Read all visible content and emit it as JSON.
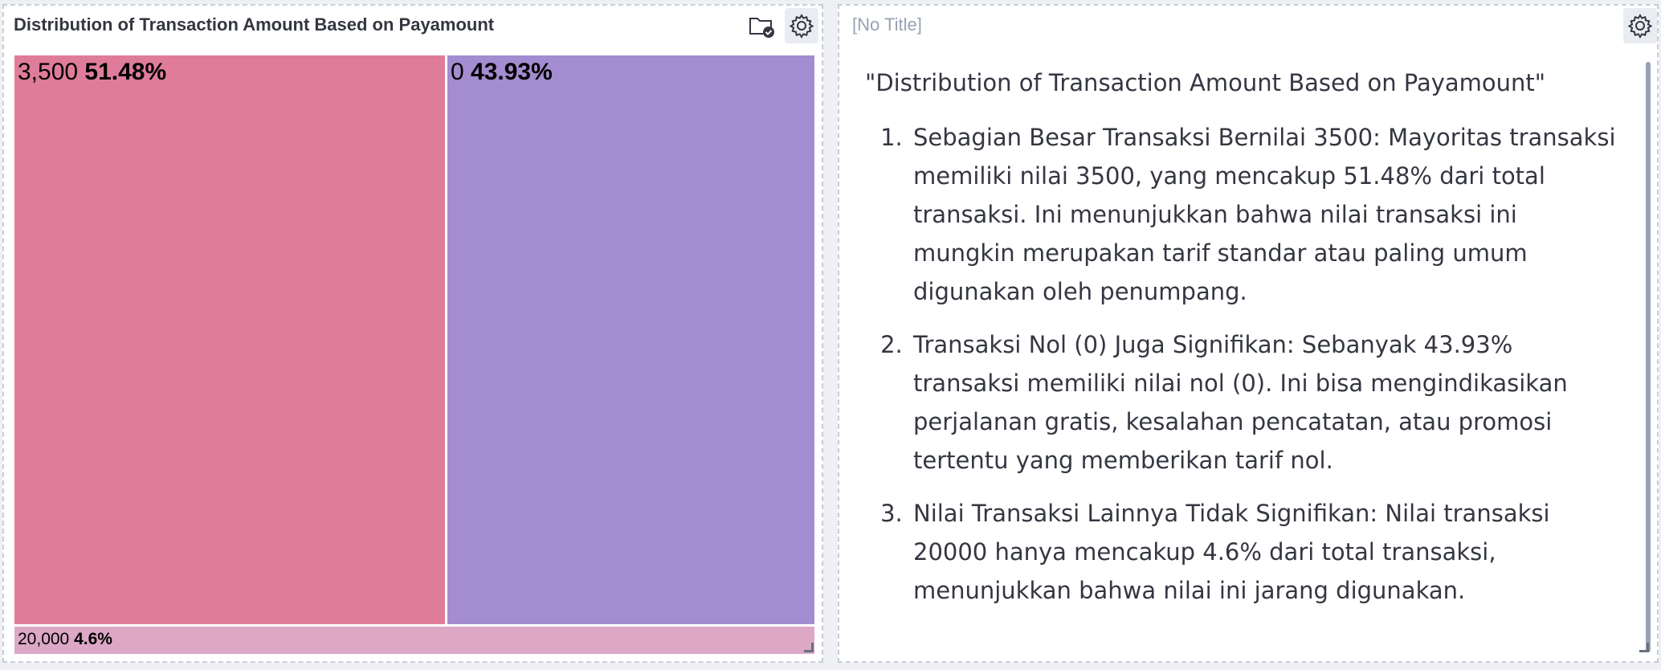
{
  "left_panel": {
    "title": "Distribution of Transaction Amount Based on Payamount",
    "icons": {
      "folder": "folder-check-icon",
      "settings": "gear-icon"
    }
  },
  "right_panel": {
    "title": "[No Title]",
    "icons": {
      "settings": "gear-icon"
    },
    "heading": "\"Distribution of Transaction Amount Based on Payamount\"",
    "items": [
      "Sebagian Besar Transaksi Bernilai 3500: Mayoritas transaksi memiliki nilai 3500, yang mencakup 51.48% dari total transaksi. Ini menunjukkan bahwa nilai transaksi ini mungkin merupakan tarif standar atau paling umum digunakan oleh penumpang.",
      "Transaksi Nol (0) Juga Signifikan: Sebanyak 43.93% transaksi memiliki nilai nol (0). Ini bisa mengindikasikan perjalanan gratis, kesalahan pencatatan, atau promosi tertentu yang memberikan tarif nol.",
      "Nilai Transaksi Lainnya Tidak Signifikan: Nilai transaksi 20000 hanya mencakup 4.6% dari total transaksi, menunjukkan bahwa nilai ini jarang digunakan."
    ]
  },
  "chart_data": {
    "type": "treemap",
    "title": "Distribution of Transaction Amount Based on Payamount",
    "tiles": [
      {
        "label": "3,500",
        "percent_label": "51.48%",
        "share": 51.48,
        "color": "#e07c9b"
      },
      {
        "label": "0",
        "percent_label": "43.93%",
        "share": 43.93,
        "color": "#a38ccf"
      },
      {
        "label": "20,000",
        "percent_label": "4.6%",
        "share": 4.6,
        "color": "#dca8c6"
      }
    ]
  }
}
